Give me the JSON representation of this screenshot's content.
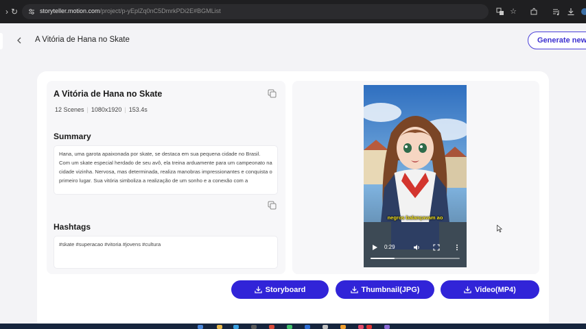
{
  "browser": {
    "url_domain": "storyteller.motion.com",
    "url_path": "/project/p-yEplZq0nC5DmrkPDi2E#BGMList"
  },
  "header": {
    "title": "A Vitória de Hana no Skate",
    "generate_button": "Generate new"
  },
  "project": {
    "title": "A Vitória de Hana no Skate",
    "scenes": "12 Scenes",
    "resolution": "1080x1920",
    "duration": "153.4s"
  },
  "summary": {
    "heading": "Summary",
    "text": "Hana, uma garota apaixonada por skate, se destaca em sua pequena cidade no Brasil. Com um skate especial herdado de seu avô, ela treina arduamente para um campeonato na cidade vizinha. Nervosa, mas determinada, realiza manobras impressionantes e conquista o primeiro lugar. Sua vitória simboliza a realização de um sonho e a conexão com a"
  },
  "hashtags": {
    "heading": "Hashtags",
    "text": "#skate #superacao #vitoria #jovens #cultura"
  },
  "video": {
    "subtitle": "negros balançavam ao",
    "time": "0:29",
    "progress": 0.27
  },
  "actions": {
    "storyboard": "Storyboard",
    "thumbnail": "Thumbnail(JPG)",
    "video": "Video(MP4)"
  },
  "colors": {
    "accent": "#3124d8",
    "outline": "#4a3fd8"
  },
  "icons": [
    "site-settings-icon",
    "translate-icon",
    "star-icon",
    "extensions-icon",
    "media-icon",
    "download-icon",
    "copy-icon",
    "download-icon",
    "play-icon",
    "volume-icon",
    "fullscreen-icon",
    "more-icon"
  ]
}
